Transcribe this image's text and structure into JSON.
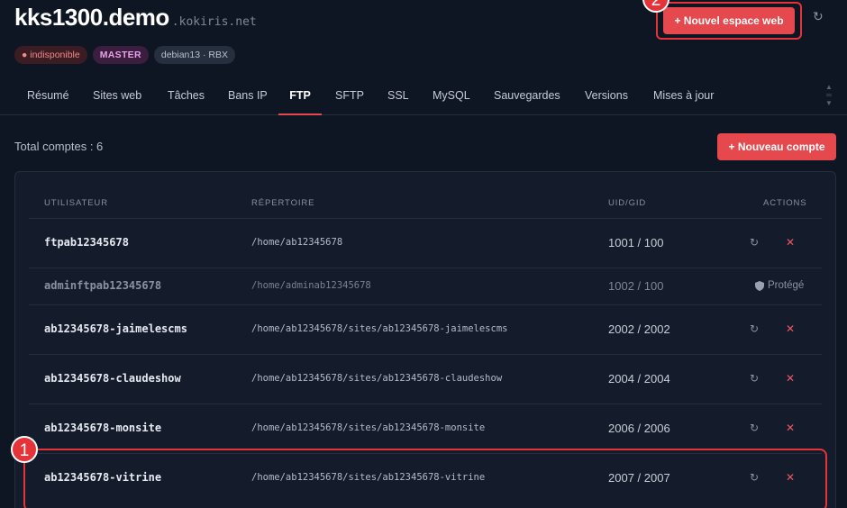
{
  "header": {
    "host": "kks1300.demo",
    "domain": ".kokiris.net",
    "badges": [
      "● indisponible",
      "MASTER",
      "debian13 · RBX"
    ],
    "new_site_label": "+ Nouvel espace web",
    "refresh_icon": "↻"
  },
  "markers": [
    "1",
    "2"
  ],
  "tabs": [
    {
      "label": "Résumé"
    },
    {
      "label": "Sites web"
    },
    {
      "label": "Tâches"
    },
    {
      "label": "Bans IP"
    },
    {
      "label": "FTP",
      "active": true
    },
    {
      "label": "SFTP"
    },
    {
      "label": "SSL"
    },
    {
      "label": "MySQL"
    },
    {
      "label": "Sauvegardes"
    },
    {
      "label": "Versions"
    },
    {
      "label": "Mises à jour"
    }
  ],
  "ftp": {
    "total_label": "Total comptes : 6",
    "new_account_label": "+ Nouveau compte",
    "columns": [
      "UTILISATEUR",
      "RÉPERTOIRE",
      "UID/GID",
      "ACTIONS"
    ],
    "protected_label": "Protégé",
    "rows": [
      {
        "user": "ftpab12345678",
        "dir": "/home/ab12345678",
        "uid": "1001 / 100"
      },
      {
        "user": "adminftpab12345678",
        "dir": "/home/adminab12345678",
        "uid": "1002 / 100",
        "protected": true
      },
      {
        "user": "ab12345678-jaimelescms",
        "dir": "/home/ab12345678/sites/ab12345678-jaimelescms",
        "uid": "2002 / 2002"
      },
      {
        "user": "ab12345678-claudeshow",
        "dir": "/home/ab12345678/sites/ab12345678-claudeshow",
        "uid": "2004 / 2004"
      },
      {
        "user": "ab12345678-monsite",
        "dir": "/home/ab12345678/sites/ab12345678-monsite",
        "uid": "2006 / 2006"
      },
      {
        "user": "ab12345678-vitrine",
        "dir": "/home/ab12345678/sites/ab12345678-vitrine",
        "uid": "2007 / 2007"
      }
    ]
  },
  "icons": {
    "refresh": "refresh-icon",
    "delete": "close-icon",
    "shield": "shield-icon"
  },
  "colors": {
    "accent": "#e5484d",
    "background": "#0f1623",
    "card": "#141c2b"
  }
}
